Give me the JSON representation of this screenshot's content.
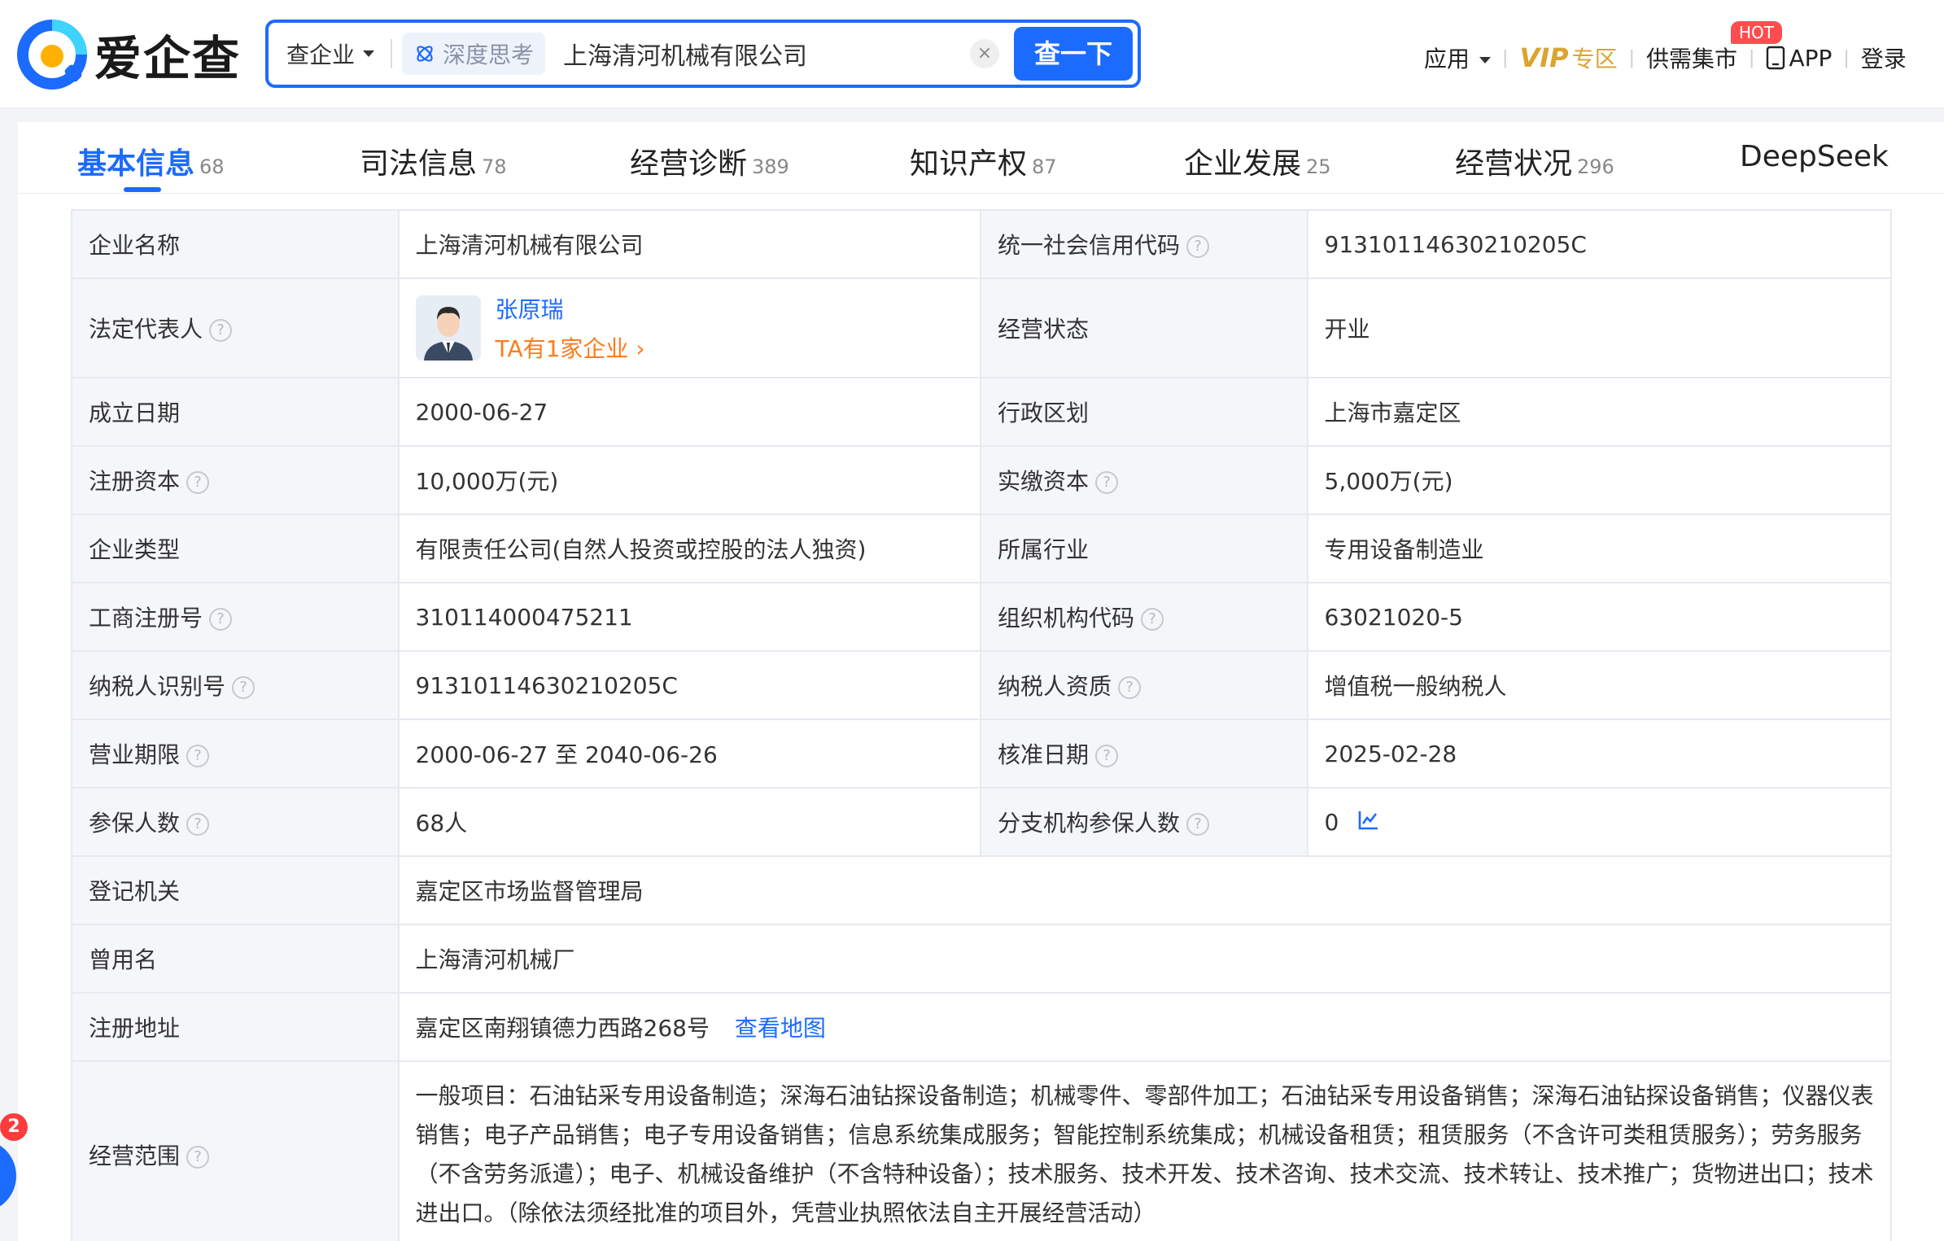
{
  "header": {
    "logo_text": "爱企查",
    "search": {
      "scope": "查企业",
      "deep_think": "深度思考",
      "query": "上海清河机械有限公司",
      "clear": "×",
      "submit": "查一下"
    },
    "nav": {
      "apps": "应用",
      "vip": "VIP",
      "vip_zone": "专区",
      "market": "供需集市",
      "hot": "HOT",
      "app": "APP",
      "login": "登录"
    }
  },
  "tabs": [
    {
      "label": "基本信息",
      "count": "68"
    },
    {
      "label": "司法信息",
      "count": "78"
    },
    {
      "label": "经营诊断",
      "count": "389"
    },
    {
      "label": "知识产权",
      "count": "87"
    },
    {
      "label": "企业发展",
      "count": "25"
    },
    {
      "label": "经营状况",
      "count": "296"
    },
    {
      "label": "DeepSeek",
      "count": ""
    }
  ],
  "info": {
    "company_name_label": "企业名称",
    "company_name": "上海清河机械有限公司",
    "credit_code_label": "统一社会信用代码",
    "credit_code": "91310114630210205C",
    "legal_rep_label": "法定代表人",
    "legal_rep_name": "张原瑞",
    "legal_rep_sub": "TA有1家企业",
    "status_label": "经营状态",
    "status": "开业",
    "founded_label": "成立日期",
    "founded": "2000-06-27",
    "region_label": "行政区划",
    "region": "上海市嘉定区",
    "reg_capital_label": "注册资本",
    "reg_capital": "10,000万(元)",
    "paid_capital_label": "实缴资本",
    "paid_capital": "5,000万(元)",
    "type_label": "企业类型",
    "type": "有限责任公司(自然人投资或控股的法人独资)",
    "industry_label": "所属行业",
    "industry": "专用设备制造业",
    "reg_no_label": "工商注册号",
    "reg_no": "310114000475211",
    "org_code_label": "组织机构代码",
    "org_code": "63021020-5",
    "tax_id_label": "纳税人识别号",
    "tax_id": "91310114630210205C",
    "tax_qual_label": "纳税人资质",
    "tax_qual": "增值税一般纳税人",
    "term_label": "营业期限",
    "term": "2000-06-27 至 2040-06-26",
    "approve_label": "核准日期",
    "approve": "2025-02-28",
    "insured_label": "参保人数",
    "insured": "68人",
    "branch_insured_label": "分支机构参保人数",
    "branch_insured": "0",
    "authority_label": "登记机关",
    "authority": "嘉定区市场监督管理局",
    "former_name_label": "曾用名",
    "former_name": "上海清河机械厂",
    "address_label": "注册地址",
    "address": "嘉定区南翔镇德力西路268号",
    "map_link": "查看地图",
    "scope_label": "经营范围",
    "scope": "一般项目：石油钻采专用设备制造；深海石油钻探设备制造；机械零件、零部件加工；石油钻采专用设备销售；深海石油钻探设备销售；仪器仪表销售；电子产品销售；电子专用设备销售；信息系统集成服务；智能控制系统集成；机械设备租赁；租赁服务（不含许可类租赁服务）；劳务服务（不含劳务派遣）；电子、机械设备维护（不含特种设备）；技术服务、技术开发、技术咨询、技术交流、技术转让、技术推广；货物进出口；技术进出口。（除依法须经批准的项目外，凭营业执照依法自主开展经营活动）"
  },
  "side_badge": "2",
  "colors": {
    "primary": "#1c6bff",
    "vip": "#d9a431",
    "orange": "#ff7a1a",
    "hot": "#ff4d4f"
  }
}
